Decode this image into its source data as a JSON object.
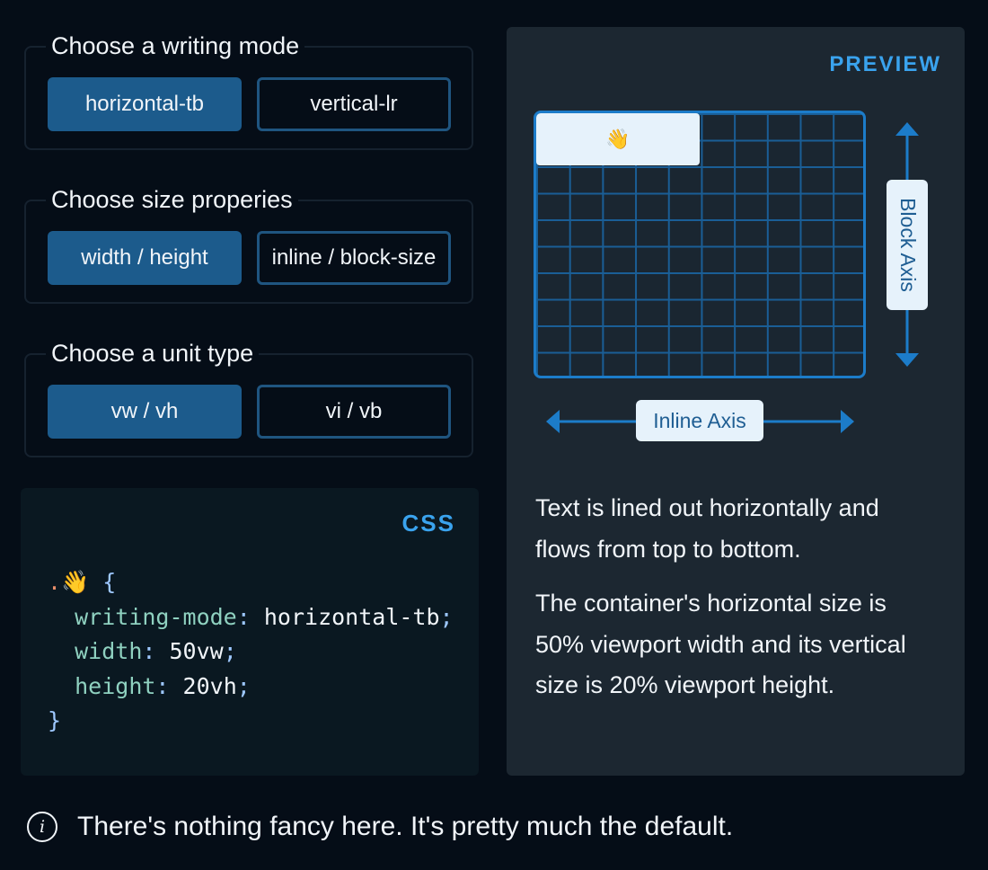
{
  "controls": {
    "writing_mode": {
      "legend": "Choose a writing mode",
      "options": [
        "horizontal-tb",
        "vertical-lr"
      ],
      "selected": "horizontal-tb"
    },
    "size_properties": {
      "legend": "Choose size properies",
      "options": [
        "width / height",
        "inline / block-size"
      ],
      "selected": "width / height"
    },
    "unit_type": {
      "legend": "Choose a unit type",
      "options": [
        "vw / vh",
        "vi / vb"
      ],
      "selected": "vw / vh"
    }
  },
  "code": {
    "label": "CSS",
    "selector_dot": ".",
    "selector_emoji": "👋",
    "open_brace": "{",
    "close_brace": "}",
    "lines": [
      {
        "prop": "writing-mode",
        "value": "horizontal-tb"
      },
      {
        "prop": "width",
        "value": "50vw"
      },
      {
        "prop": "height",
        "value": "20vh"
      }
    ]
  },
  "preview": {
    "label": "PREVIEW",
    "box_emoji": "👋",
    "inline_axis_label": "Inline Axis",
    "block_axis_label": "Block Axis",
    "description_1": "Text is lined out horizontally and flows from top to bottom.",
    "description_2": "The container's horizontal size is 50% viewport width and its vertical size is 20% viewport height."
  },
  "note": {
    "icon": "info-icon",
    "text": "There's nothing fancy here. It's pretty much the default."
  },
  "colors": {
    "background": "#050d17",
    "selected_button": "#1c5b8c",
    "accent": "#3aa3ee",
    "grid_line": "#1a5e96"
  }
}
